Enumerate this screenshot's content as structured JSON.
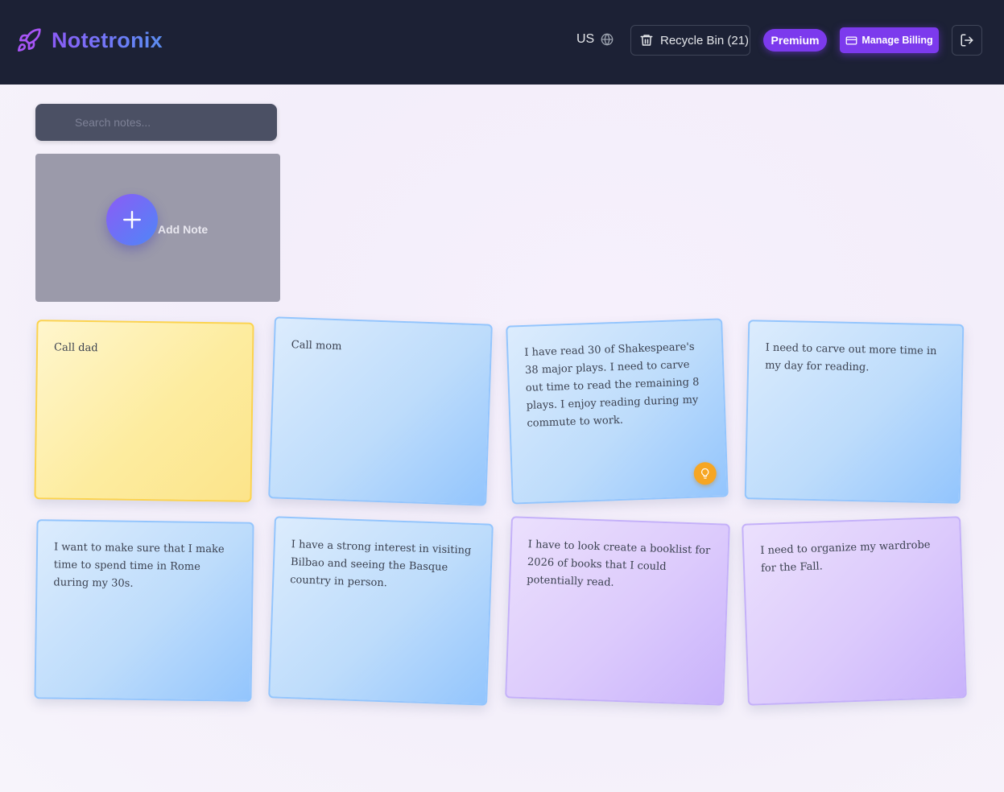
{
  "header": {
    "brand_name": "Notetronix",
    "locale_label": "US",
    "recycle_bin_label": "Recycle Bin (21)",
    "premium_label": "Premium",
    "manage_billing_label": "Manage Billing"
  },
  "search": {
    "placeholder": "Search notes..."
  },
  "add_note": {
    "label": "Add Note"
  },
  "notes": [
    {
      "text": "Call dad",
      "color": "yellow"
    },
    {
      "text": "Call mom",
      "color": "blue"
    },
    {
      "text": "I have read 30 of Shakespeare's 38 major plays. I need to carve out time to read the remaining 8 plays. I enjoy reading during my commute to work.",
      "color": "blue",
      "has_insight": true
    },
    {
      "text": "I need to carve out more time in my day for reading.",
      "color": "blue"
    },
    {
      "text": "I want to make sure that I make time to spend time in Rome during my 30s.",
      "color": "blue"
    },
    {
      "text": "I have a strong interest in visiting Bilbao and seeing the Basque country in person.",
      "color": "blue"
    },
    {
      "text": "I have to look create a booklist for 2026 of books that I could potentially read.",
      "color": "purple"
    },
    {
      "text": "I need to organize my wardrobe for the Fall.",
      "color": "purple"
    }
  ],
  "colors": {
    "header_bg": "#1c2135",
    "accent": "#7c3aed",
    "insight": "#f6a623"
  },
  "icons": [
    "rocket-icon",
    "globe-icon",
    "trash-icon",
    "credit-card-icon",
    "logout-icon",
    "plus-icon",
    "lightbulb-icon"
  ]
}
